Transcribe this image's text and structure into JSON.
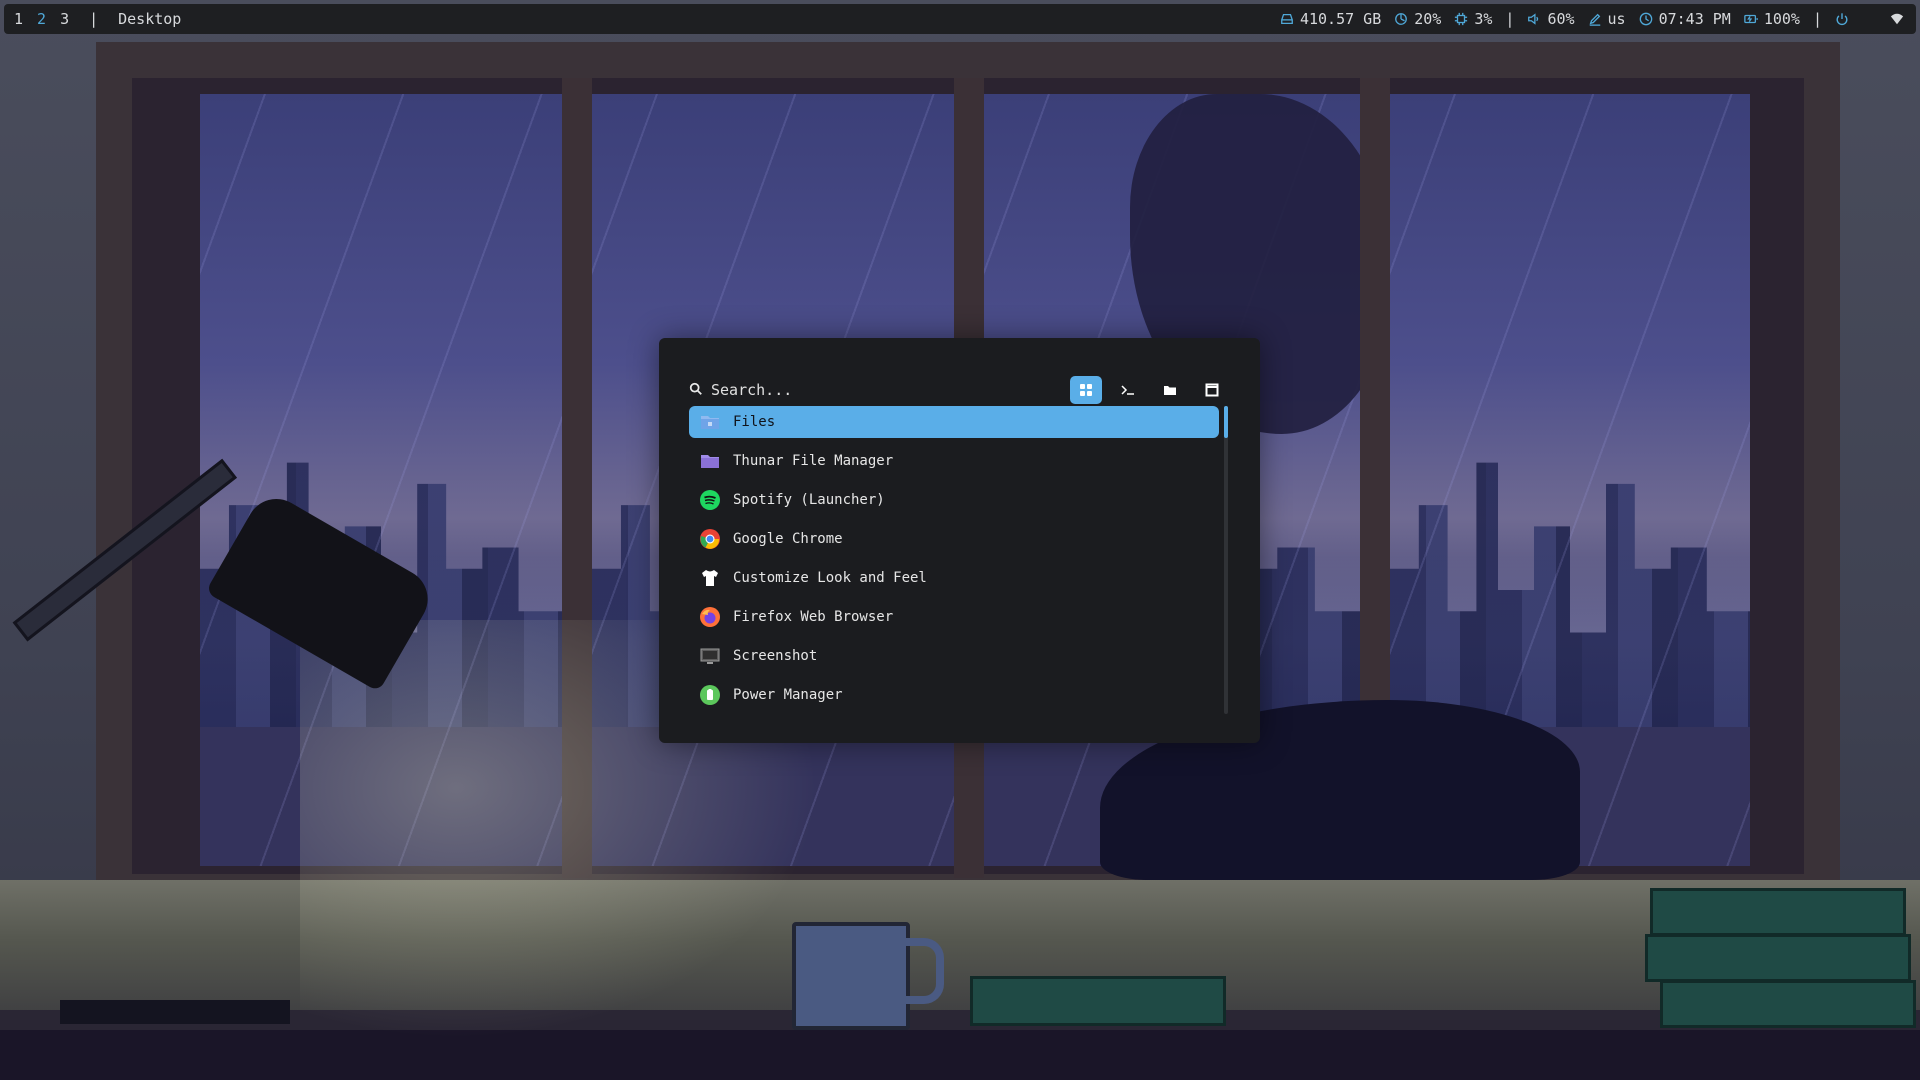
{
  "topbar": {
    "workspaces": [
      "1",
      "2",
      "3"
    ],
    "active_workspace": "2",
    "separator": "|",
    "title": "Desktop",
    "disk": "410.57 GB",
    "cpu": "20%",
    "memory": "3%",
    "volume": "60%",
    "keyboard": "us",
    "time": "07:43 PM",
    "battery": "100%"
  },
  "launcher": {
    "search_placeholder": "Search...",
    "modes": [
      "apps-grid-icon",
      "terminal-icon",
      "folder-icon",
      "window-icon"
    ],
    "items": [
      {
        "label": "Files",
        "icon": "files-icon",
        "color": "#6fa4e8"
      },
      {
        "label": "Thunar File Manager",
        "icon": "folder-icon",
        "color": "#8a70d6"
      },
      {
        "label": "Spotify (Launcher)",
        "icon": "spotify-icon",
        "color": "#1ed760"
      },
      {
        "label": "Google Chrome",
        "icon": "chrome-icon",
        "color": "#e94235"
      },
      {
        "label": "Customize Look and Feel",
        "icon": "shirt-icon",
        "color": "#ffffff"
      },
      {
        "label": "Firefox Web Browser",
        "icon": "firefox-icon",
        "color": "#ff7139"
      },
      {
        "label": "Screenshot",
        "icon": "screenshot-icon",
        "color": "#9a9a9a"
      },
      {
        "label": "Power Manager",
        "icon": "battery-icon",
        "color": "#5cc75c"
      }
    ],
    "selected_index": 0,
    "accent": "#5aaee8"
  }
}
